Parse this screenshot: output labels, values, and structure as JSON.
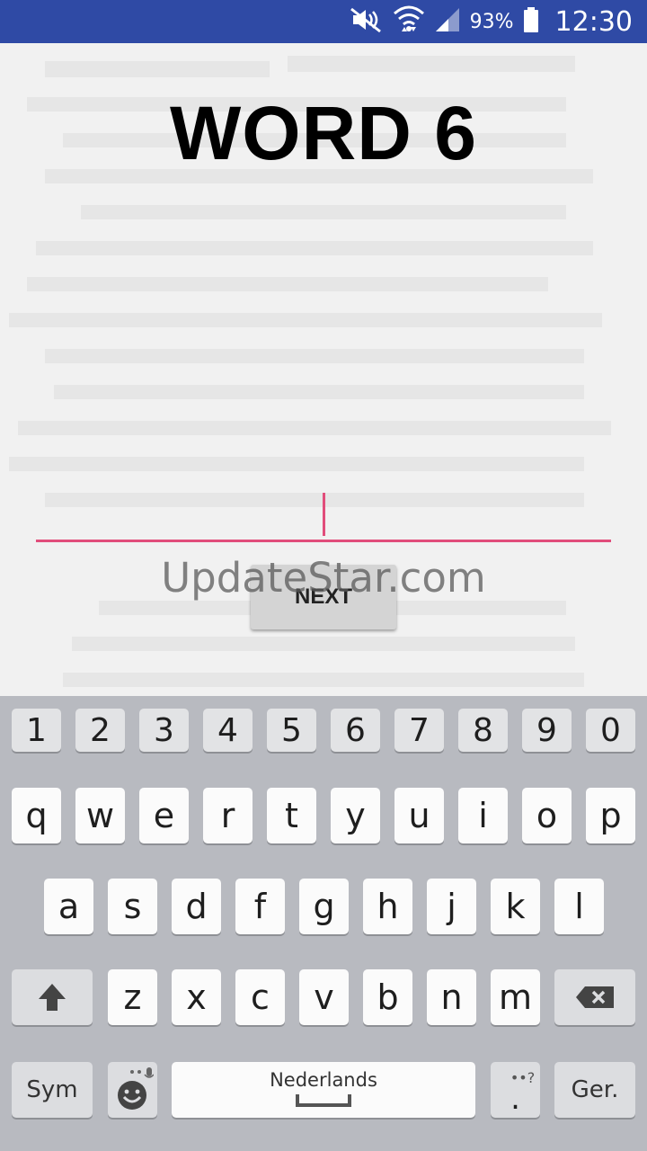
{
  "status_bar": {
    "battery": "93%",
    "time": "12:30",
    "icons": [
      "mute-icon",
      "wifi-icon",
      "signal-icon",
      "battery-icon"
    ]
  },
  "app": {
    "title": "WORD 6",
    "input": {
      "value": ""
    },
    "next_button": "NEXT",
    "watermark": "UpdateStar.com"
  },
  "keyboard": {
    "number_row": [
      "1",
      "2",
      "3",
      "4",
      "5",
      "6",
      "7",
      "8",
      "9",
      "0"
    ],
    "row1": [
      "q",
      "w",
      "e",
      "r",
      "t",
      "y",
      "u",
      "i",
      "o",
      "p"
    ],
    "row2": [
      "a",
      "s",
      "d",
      "f",
      "g",
      "h",
      "j",
      "k",
      "l"
    ],
    "row3": [
      "z",
      "x",
      "c",
      "v",
      "b",
      "n",
      "m"
    ],
    "sym": "Sym",
    "space_language": "Nederlands",
    "period": ".",
    "period_hint": "••?",
    "done": "Ger."
  },
  "colors": {
    "status_bar": "#2f4aa5",
    "accent": "#e14d7b",
    "keyboard_bg": "#b8bac0"
  }
}
